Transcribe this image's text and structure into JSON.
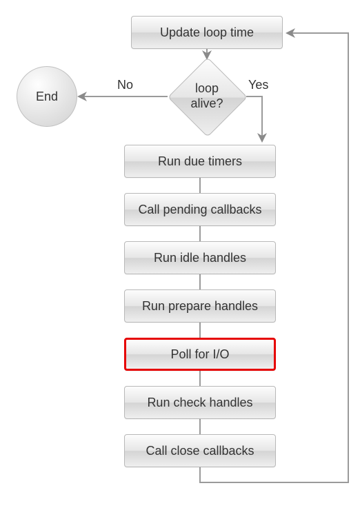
{
  "chart_data": {
    "type": "flowchart",
    "nodes": [
      {
        "id": "update_loop_time",
        "shape": "rect",
        "label": "Update loop time"
      },
      {
        "id": "loop_alive",
        "shape": "diamond",
        "label": "loop\nalive?"
      },
      {
        "id": "end",
        "shape": "circle",
        "label": "End"
      },
      {
        "id": "run_due_timers",
        "shape": "rect",
        "label": "Run due timers"
      },
      {
        "id": "call_pending_callbacks",
        "shape": "rect",
        "label": "Call pending callbacks"
      },
      {
        "id": "run_idle_handles",
        "shape": "rect",
        "label": "Run idle handles"
      },
      {
        "id": "run_prepare_handles",
        "shape": "rect",
        "label": "Run prepare handles"
      },
      {
        "id": "poll_for_io",
        "shape": "rect",
        "label": "Poll for I/O",
        "highlighted": true
      },
      {
        "id": "run_check_handles",
        "shape": "rect",
        "label": "Run check handles"
      },
      {
        "id": "call_close_callbacks",
        "shape": "rect",
        "label": "Call close callbacks"
      }
    ],
    "edges": [
      {
        "from": "update_loop_time",
        "to": "loop_alive"
      },
      {
        "from": "loop_alive",
        "to": "end",
        "label": "No"
      },
      {
        "from": "loop_alive",
        "to": "run_due_timers",
        "label": "Yes"
      },
      {
        "from": "run_due_timers",
        "to": "call_pending_callbacks"
      },
      {
        "from": "call_pending_callbacks",
        "to": "run_idle_handles"
      },
      {
        "from": "run_idle_handles",
        "to": "run_prepare_handles"
      },
      {
        "from": "run_prepare_handles",
        "to": "poll_for_io"
      },
      {
        "from": "poll_for_io",
        "to": "run_check_handles"
      },
      {
        "from": "run_check_handles",
        "to": "call_close_callbacks"
      },
      {
        "from": "call_close_callbacks",
        "to": "update_loop_time"
      }
    ]
  },
  "labels": {
    "update_loop_time": "Update loop time",
    "loop_alive_l1": "loop",
    "loop_alive_l2": "alive?",
    "end": "End",
    "no": "No",
    "yes": "Yes",
    "run_due_timers": "Run due timers",
    "call_pending_callbacks": "Call pending callbacks",
    "run_idle_handles": "Run idle handles",
    "run_prepare_handles": "Run prepare handles",
    "poll_for_io": "Poll for I/O",
    "run_check_handles": "Run check handles",
    "call_close_callbacks": "Call close callbacks"
  }
}
